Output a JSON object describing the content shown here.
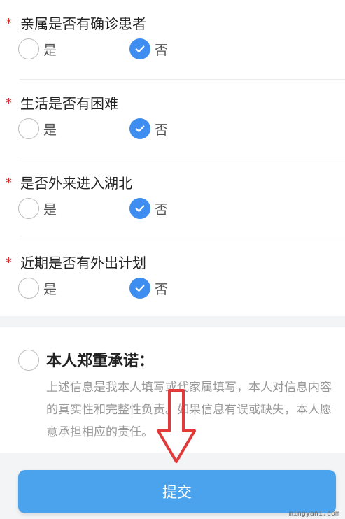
{
  "questions": [
    {
      "label": "亲属是否有确诊患者",
      "yes_label": "是",
      "no_label": "否",
      "selected": "no"
    },
    {
      "label": "生活是否有困难",
      "yes_label": "是",
      "no_label": "否",
      "selected": "no"
    },
    {
      "label": "是否外来进入湖北",
      "yes_label": "是",
      "no_label": "否",
      "selected": "no"
    },
    {
      "label": "近期是否有外出计划",
      "yes_label": "是",
      "no_label": "否",
      "selected": "no"
    }
  ],
  "required_mark": "*",
  "pledge": {
    "title": "本人郑重承诺：",
    "text": "上述信息是我本人填写或代家属填写，本人对信息内容的真实性和完整性负责。如果信息有误或缺失，本人愿意承担相应的责任。",
    "checked": false
  },
  "submit_label": "提交",
  "watermark": "mingyan1.com",
  "colors": {
    "accent": "#3d8ef0",
    "submit": "#4aa3ec",
    "required": "#e02a2a",
    "annotation_arrow": "#e03a3a"
  },
  "icons": {
    "checked": "check-icon",
    "annotation": "arrow-down-icon"
  }
}
